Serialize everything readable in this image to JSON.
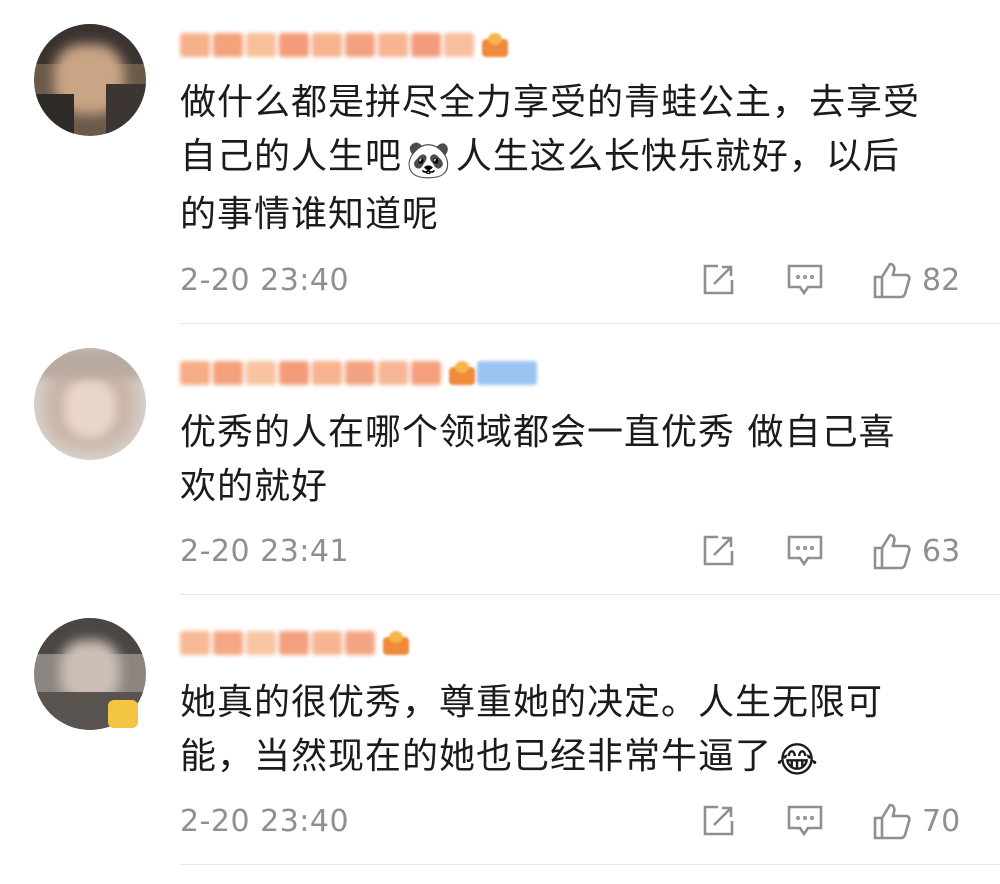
{
  "comments": [
    {
      "text_lines": [
        "做什么都是拼尽全力享受的青蛙公主，去享受",
        "自己的人生吧",
        "人生这么长快乐就好，以后",
        "的事情谁知道呢"
      ],
      "emoji": "🐼",
      "time": "2-20 23:40",
      "likes": "82",
      "name_colors": [
        "#f6b08a",
        "#f4a37a",
        "#f7c09a",
        "#f39a78",
        "#f5b38e",
        "#f2a07e",
        "#f6b491",
        "#f39c7c",
        "#f7bf9d"
      ]
    },
    {
      "text_lines": [
        "优秀的人在哪个领域都会一直优秀 做自己喜",
        "欢的就好"
      ],
      "time": "2-20 23:41",
      "likes": "63",
      "name_colors": [
        "#f6ad86",
        "#f4a27c",
        "#f7c3a0",
        "#f39b79",
        "#f5b38e",
        "#f2a482",
        "#f6b694",
        "#f4a07f"
      ]
    },
    {
      "text_lines": [
        "她真的很优秀，尊重她的决定。人生无限可",
        "能，当然现在的她也已经非常牛逼了"
      ],
      "emoji": "😂",
      "time": "2-20 23:40",
      "likes": "70",
      "name_colors": [
        "#f7b996",
        "#f5a884",
        "#f8c6a4",
        "#f4a07e",
        "#f6b592",
        "#f3a683"
      ]
    }
  ],
  "icons": {
    "share": "share-icon",
    "comment": "comment-icon",
    "like": "thumbs-up-icon"
  },
  "colors": {
    "meta_gray": "#8f8f8f",
    "text": "#1b1b1b",
    "divider": "#e6e6e6"
  }
}
